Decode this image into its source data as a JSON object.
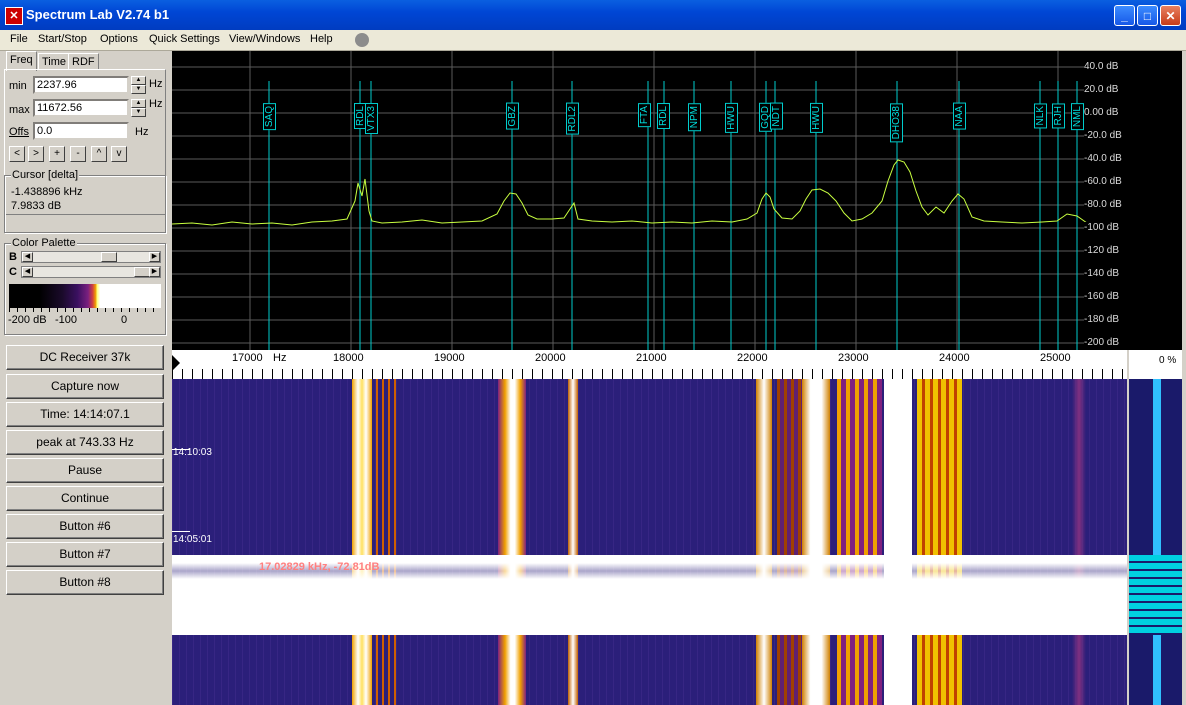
{
  "window": {
    "title": "Spectrum Lab V2.74 b1",
    "minimize": "_",
    "maximize": "□",
    "close": "✕"
  },
  "menu": [
    "File",
    "Start/Stop",
    "Options",
    "Quick Settings",
    "View/Windows",
    "Help"
  ],
  "tabs": [
    "Freq",
    "Time",
    "RDF"
  ],
  "freq": {
    "min_label": "min",
    "min_value": "2237.96",
    "max_label": "max",
    "max_value": "11672.56",
    "offs_label": "Offs",
    "offs_value": "0.0",
    "unit": "Hz",
    "nav_buttons": [
      "<",
      ">",
      "+",
      "-",
      "^",
      "v"
    ]
  },
  "cursor": {
    "title": "Cursor [delta]",
    "freq": "-1.438896 kHz",
    "level": "7.9833 dB"
  },
  "palette": {
    "title": "Color Palette",
    "b_label": "B",
    "c_label": "C",
    "scale": [
      "-200 dB",
      "-100",
      "0"
    ]
  },
  "buttons": [
    "DC Receiver 37k",
    "Capture now",
    "Time:  14:14:07.1",
    "peak at 743.33 Hz",
    "Pause",
    "Continue",
    "Button #6",
    "Button #7",
    "Button #8"
  ],
  "spectrum": {
    "db_labels": [
      "40.0 dB",
      "20.0 dB",
      "0.00 dB",
      "-20.0 dB",
      "-40.0 dB",
      "-60.0 dB",
      "-80.0 dB",
      "-100 dB",
      "-120 dB",
      "-140 dB",
      "-160 dB",
      "-180 dB",
      "-200 dB"
    ],
    "markers": [
      "SAQ",
      "RDL",
      "VTX3",
      "GBZ",
      "RDL2",
      "FTA",
      "RDL",
      "NPM",
      "HWU",
      "GQD",
      "NDT",
      "HWU",
      "DHO38",
      "NAA",
      "NLK",
      "RJH",
      "NML"
    ],
    "freq_labels": [
      "17000",
      "Hz",
      "18000",
      "19000",
      "20000",
      "21000",
      "22000",
      "23000",
      "24000",
      "25000"
    ],
    "side_label": "0 %"
  },
  "waterfall": {
    "time_labels": [
      "14:10:03",
      "14:05:01"
    ],
    "cursor_readout": "17.02829 kHz, -72.81dB"
  },
  "colors": {
    "title_bar": "#0054e3",
    "trace": "#c8ff40",
    "markers": "#00cccc",
    "grid": "#5a5a5a"
  }
}
